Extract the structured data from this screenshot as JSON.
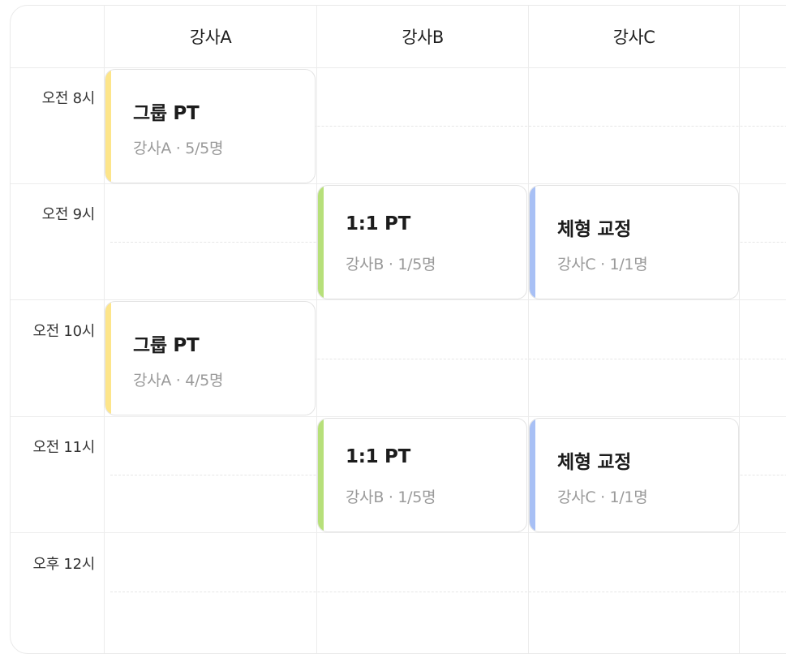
{
  "instructors": [
    "강사A",
    "강사B",
    "강사C"
  ],
  "times": [
    "오전 8시",
    "오전 9시",
    "오전 10시",
    "오전 11시",
    "오후 12시"
  ],
  "colors": {
    "yellow": "#fde58a",
    "green": "#b7e07a",
    "blue": "#a8c0f5"
  },
  "events": [
    {
      "title": "그룹 PT",
      "meta": "강사A · 5/5명",
      "color": "yellow"
    },
    {
      "title": "1:1 PT",
      "meta": "강사B · 1/5명",
      "color": "green"
    },
    {
      "title": "체형 교정",
      "meta": "강사C · 1/1명",
      "color": "blue"
    },
    {
      "title": "그룹 PT",
      "meta": "강사A · 4/5명",
      "color": "yellow"
    },
    {
      "title": "1:1 PT",
      "meta": "강사B · 1/5명",
      "color": "green"
    },
    {
      "title": "체형 교정",
      "meta": "강사C · 1/1명",
      "color": "blue"
    }
  ]
}
